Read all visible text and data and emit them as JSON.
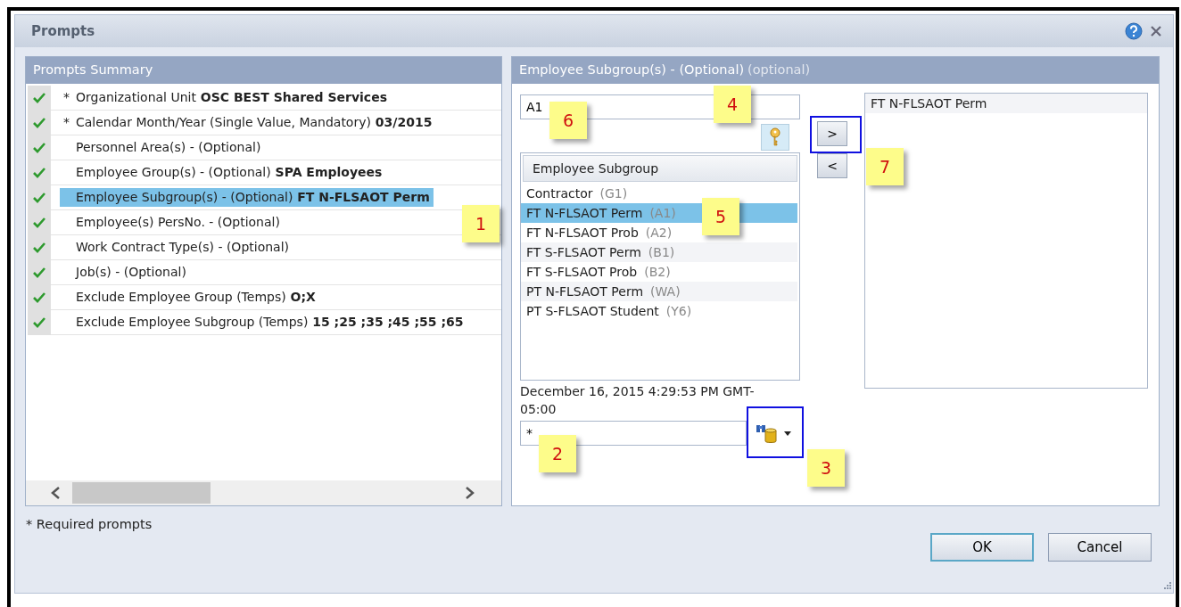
{
  "window": {
    "title": "Prompts"
  },
  "summary": {
    "title": "Prompts Summary",
    "items": [
      {
        "marker": "*",
        "label": "Organizational Unit",
        "value": "OSC BEST Shared Services",
        "done": true,
        "selected": false
      },
      {
        "marker": "*",
        "label": "Calendar Month/Year (Single Value, Mandatory)",
        "value": "03/2015",
        "done": true,
        "selected": false
      },
      {
        "label": "Personnel Area(s) - (Optional)",
        "done": true,
        "selected": false
      },
      {
        "label": "Employee Group(s) - (Optional)",
        "value": "SPA Employees",
        "done": true,
        "selected": false
      },
      {
        "label": "Employee Subgroup(s) - (Optional)",
        "value": "FT N-FLSAOT Perm",
        "done": true,
        "selected": true
      },
      {
        "label": "Employee(s) PersNo. - (Optional)",
        "done": true,
        "selected": false
      },
      {
        "label": "Work Contract Type(s) - (Optional)",
        "done": true,
        "selected": false
      },
      {
        "label": "Job(s) - (Optional)",
        "done": true,
        "selected": false
      },
      {
        "label": "Exclude Employee Group (Temps)",
        "value": "O;X",
        "done": true,
        "selected": false
      },
      {
        "label": "Exclude Employee Subgroup (Temps)",
        "value": "15 ;25 ;35 ;45 ;55 ;65",
        "done": true,
        "selected": false
      }
    ]
  },
  "detail": {
    "title": "Employee Subgroup(s) - (Optional)",
    "title_note": "(optional)",
    "search_value": "A1",
    "list_header": "Employee Subgroup",
    "options": [
      {
        "name": "Contractor",
        "code": "(G1)",
        "selected": false
      },
      {
        "name": "FT N-FLSAOT Perm",
        "code": "(A1)",
        "selected": true
      },
      {
        "name": "FT N-FLSAOT Prob",
        "code": "(A2)",
        "selected": false
      },
      {
        "name": "FT S-FLSAOT Perm",
        "code": "(B1)",
        "selected": false
      },
      {
        "name": "FT S-FLSAOT Prob",
        "code": "(B2)",
        "selected": false
      },
      {
        "name": "PT N-FLSAOT Perm",
        "code": "(WA)",
        "selected": false
      },
      {
        "name": "PT S-FLSAOT Student",
        "code": "(Y6)",
        "selected": false
      }
    ],
    "add_button": ">",
    "remove_button": "<",
    "chosen": [
      "FT N-FLSAOT Perm"
    ],
    "timestamp": "December 16, 2015 4:29:53 PM GMT-05:00",
    "filter_value": "*"
  },
  "footer_note": "* Required prompts",
  "buttons": [
    "OK",
    "Cancel"
  ],
  "callouts": [
    "1",
    "2",
    "3",
    "4",
    "5",
    "6",
    "7"
  ]
}
